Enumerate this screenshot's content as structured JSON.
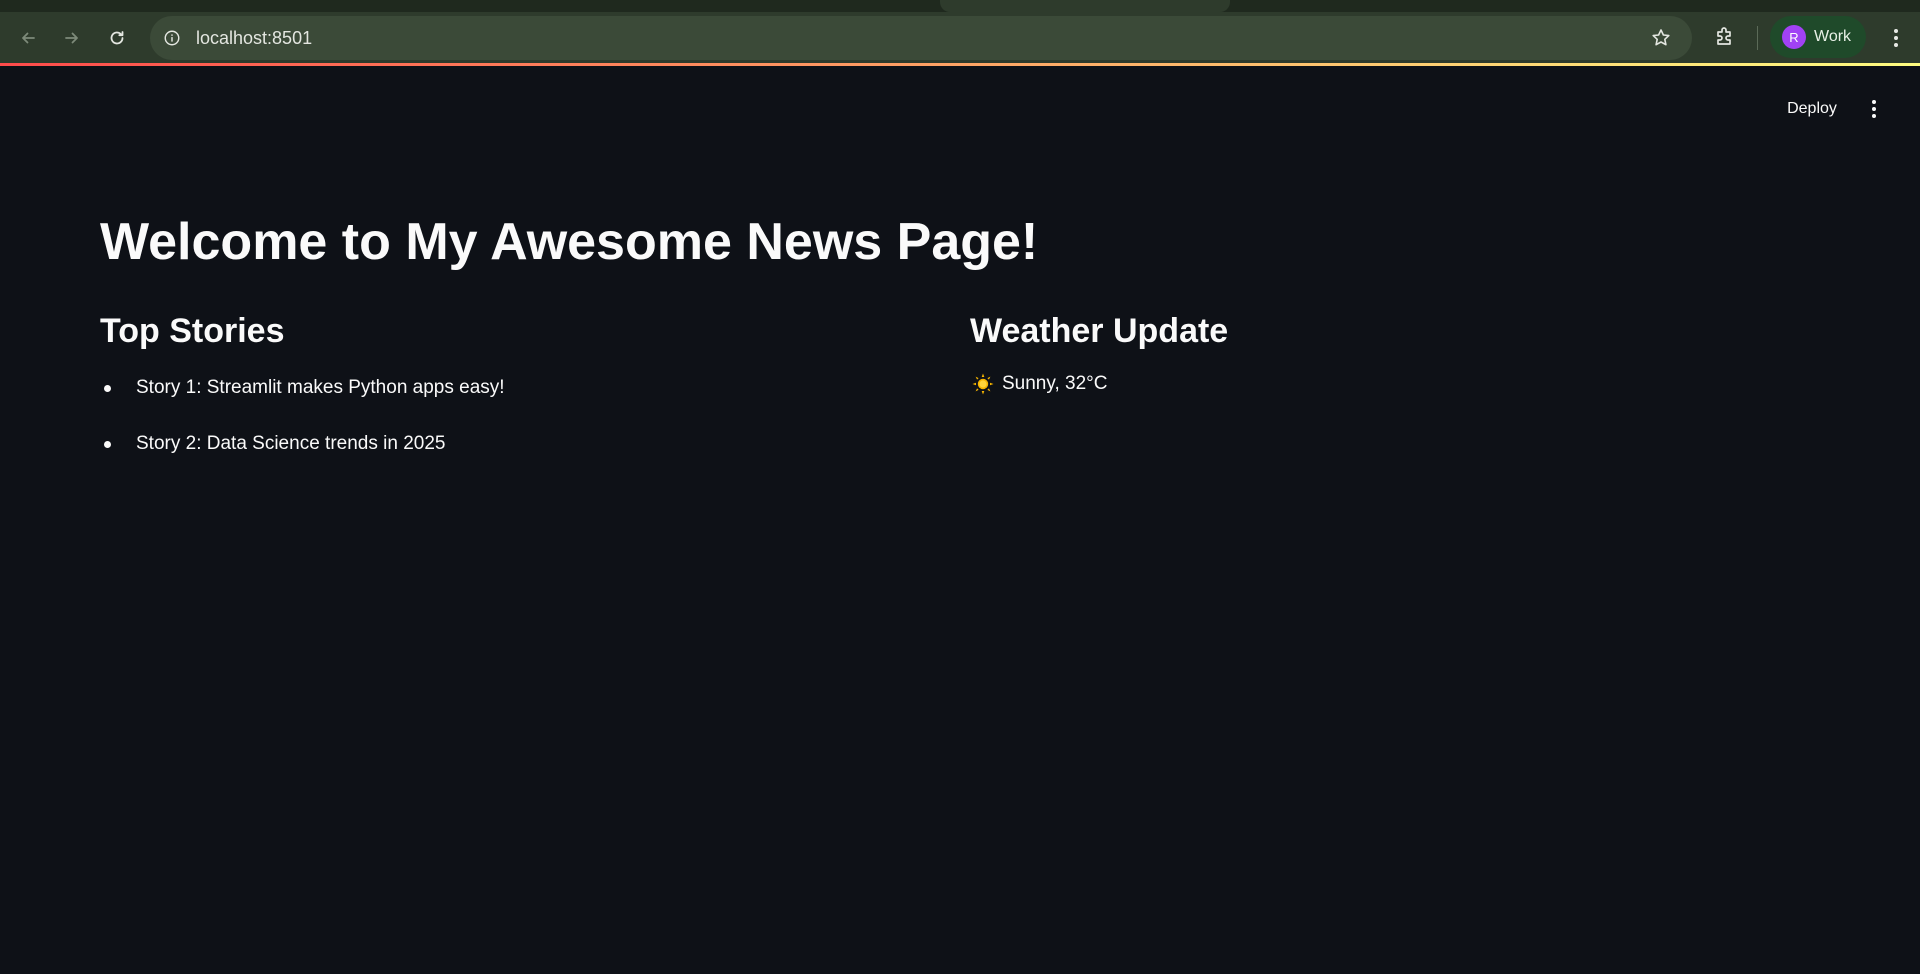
{
  "browser": {
    "url": "localhost:8501",
    "profile": {
      "initial": "R",
      "label": "Work",
      "avatar_color": "#a142f4"
    },
    "icons": {
      "back": "back-arrow-icon",
      "forward": "forward-arrow-icon",
      "reload": "reload-icon",
      "site_info": "info-icon",
      "bookmark": "star-icon",
      "extensions": "puzzle-icon",
      "menu": "kebab-menu-icon"
    }
  },
  "app": {
    "header": {
      "deploy_label": "Deploy",
      "menu_icon": "kebab-menu-icon"
    },
    "title": "Welcome to My Awesome News Page!",
    "top_stories": {
      "heading": "Top Stories",
      "items": [
        "Story 1: Streamlit makes Python apps easy!",
        "Story 2: Data Science trends in 2025"
      ]
    },
    "weather": {
      "heading": "Weather Update",
      "icon": "sun-icon",
      "text": "Sunny, 32°C"
    },
    "colors": {
      "background": "#0e1117",
      "text": "#fafafa",
      "gradient_start": "#ff4b4b",
      "gradient_end": "#fffd80"
    }
  }
}
